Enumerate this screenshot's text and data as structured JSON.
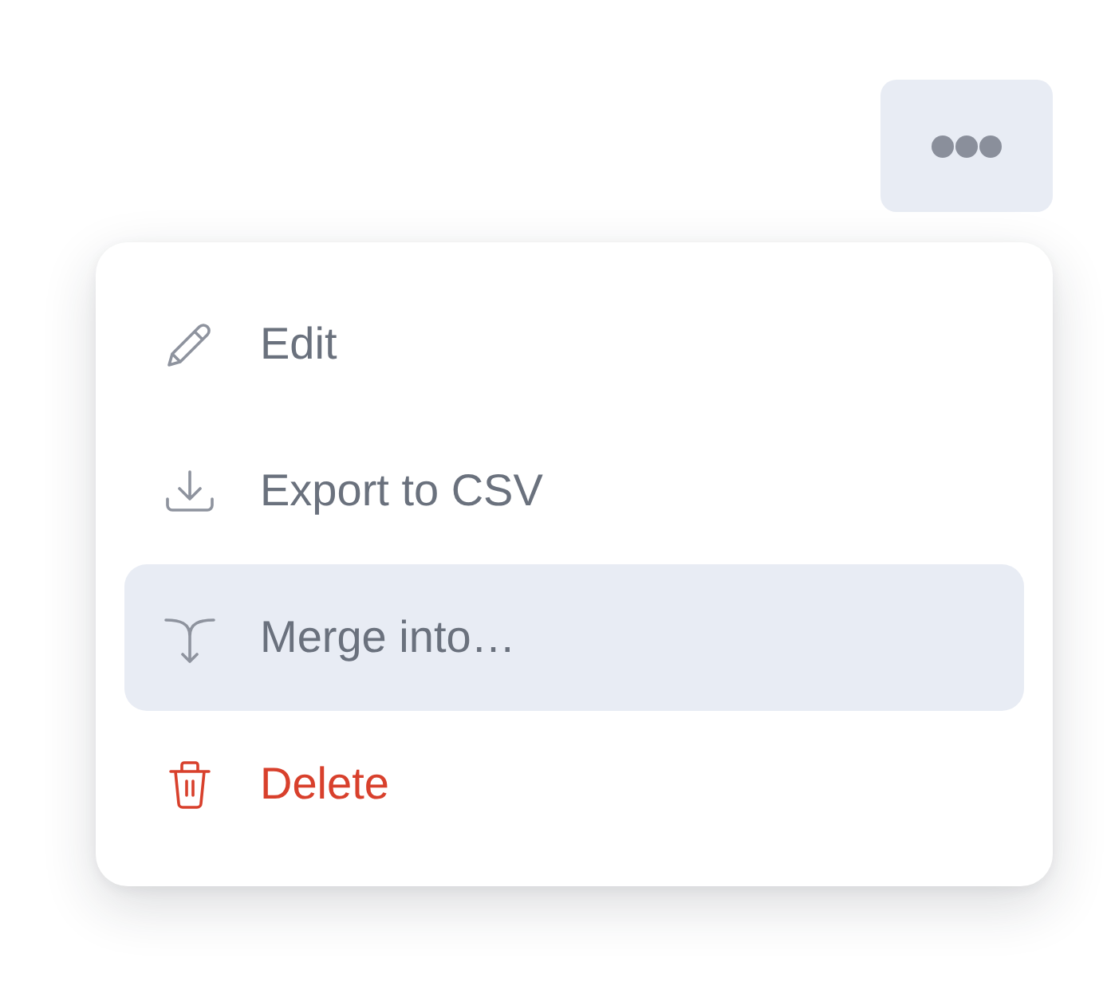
{
  "more_button": {
    "selected": true
  },
  "menu": {
    "items": [
      {
        "label": "Edit",
        "kind": "edit",
        "selected": false
      },
      {
        "label": "Export to CSV",
        "kind": "export",
        "selected": false
      },
      {
        "label": "Merge into…",
        "kind": "merge",
        "selected": true
      },
      {
        "label": "Delete",
        "kind": "delete",
        "selected": false
      }
    ]
  }
}
